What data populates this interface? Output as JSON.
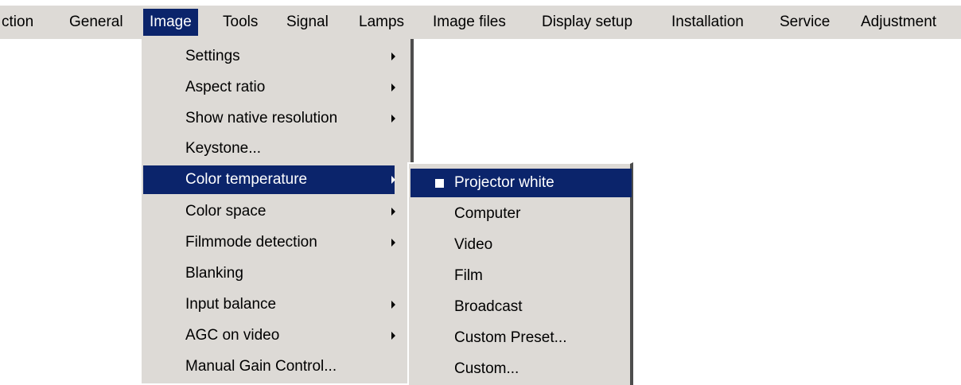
{
  "menubar": {
    "items": [
      {
        "label": "ction"
      },
      {
        "label": "General"
      },
      {
        "label": "Image"
      },
      {
        "label": "Tools"
      },
      {
        "label": "Signal"
      },
      {
        "label": "Lamps"
      },
      {
        "label": "Image files"
      },
      {
        "label": "Display setup"
      },
      {
        "label": "Installation"
      },
      {
        "label": "Service"
      },
      {
        "label": "Adjustment"
      }
    ],
    "active": "Image"
  },
  "image_menu": {
    "items": [
      {
        "label": "Settings",
        "submenu": true
      },
      {
        "label": "Aspect ratio",
        "submenu": true
      },
      {
        "label": "Show native resolution",
        "submenu": true
      },
      {
        "label": "Keystone...",
        "submenu": false
      },
      {
        "label": "Color temperature",
        "submenu": true,
        "highlighted": true
      },
      {
        "label": "Color space",
        "submenu": true
      },
      {
        "label": "Filmmode detection",
        "submenu": true
      },
      {
        "label": "Blanking",
        "submenu": false
      },
      {
        "label": "Input balance",
        "submenu": true
      },
      {
        "label": "AGC on video",
        "submenu": true
      },
      {
        "label": "Manual Gain Control...",
        "submenu": false
      }
    ]
  },
  "color_temperature_submenu": {
    "items": [
      {
        "label": "Projector white",
        "selected": true,
        "highlighted": true
      },
      {
        "label": "Computer"
      },
      {
        "label": "Video"
      },
      {
        "label": "Film"
      },
      {
        "label": "Broadcast"
      },
      {
        "label": "Custom Preset..."
      },
      {
        "label": "Custom..."
      }
    ]
  },
  "colors": {
    "menu_background": "#dddad6",
    "highlight": "#0b246b",
    "highlight_text": "#ffffff",
    "shadow": "#4d4d4d"
  }
}
